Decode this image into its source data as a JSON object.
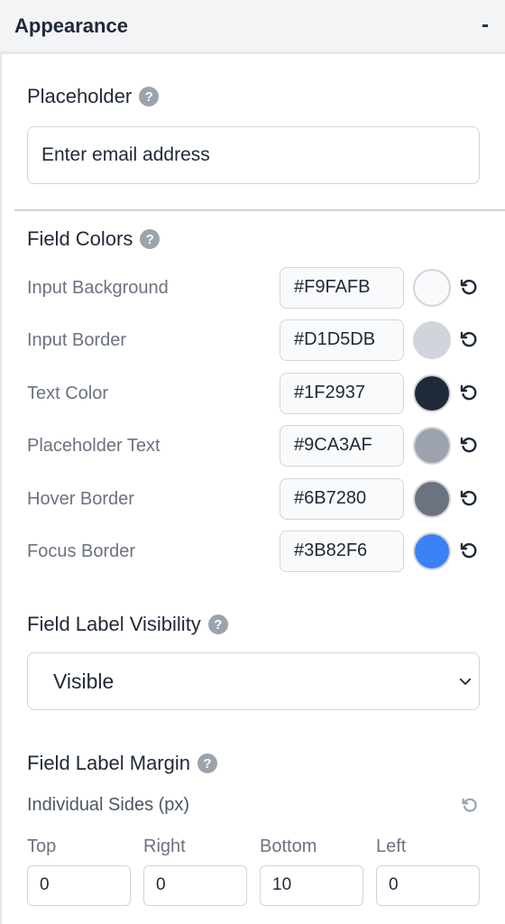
{
  "section": {
    "title": "Appearance",
    "toggle": "-"
  },
  "placeholder": {
    "label": "Placeholder",
    "help": "?",
    "value": "Enter email address"
  },
  "field_colors": {
    "label": "Field Colors",
    "help": "?",
    "rows": [
      {
        "label": "Input Background",
        "hex": "#F9FAFB",
        "color": "#F9FAFB"
      },
      {
        "label": "Input Border",
        "hex": "#D1D5DB",
        "color": "#D1D5DB"
      },
      {
        "label": "Text Color",
        "hex": "#1F2937",
        "color": "#1F2937"
      },
      {
        "label": "Placeholder Text",
        "hex": "#9CA3AF",
        "color": "#9CA3AF"
      },
      {
        "label": "Hover Border",
        "hex": "#6B7280",
        "color": "#6B7280"
      },
      {
        "label": "Focus Border",
        "hex": "#3B82F6",
        "color": "#3B82F6"
      }
    ]
  },
  "label_visibility": {
    "label": "Field Label Visibility",
    "help": "?",
    "selected": "Visible"
  },
  "label_margin": {
    "label": "Field Label Margin",
    "help": "?",
    "sub_label": "Individual Sides (px)",
    "sides": [
      {
        "label": "Top",
        "value": "0"
      },
      {
        "label": "Right",
        "value": "0"
      },
      {
        "label": "Bottom",
        "value": "10"
      },
      {
        "label": "Left",
        "value": "0"
      }
    ]
  },
  "icons": {
    "help": "question-circle-icon",
    "reset": "reset-icon",
    "chevron": "chevron-down-icon"
  }
}
